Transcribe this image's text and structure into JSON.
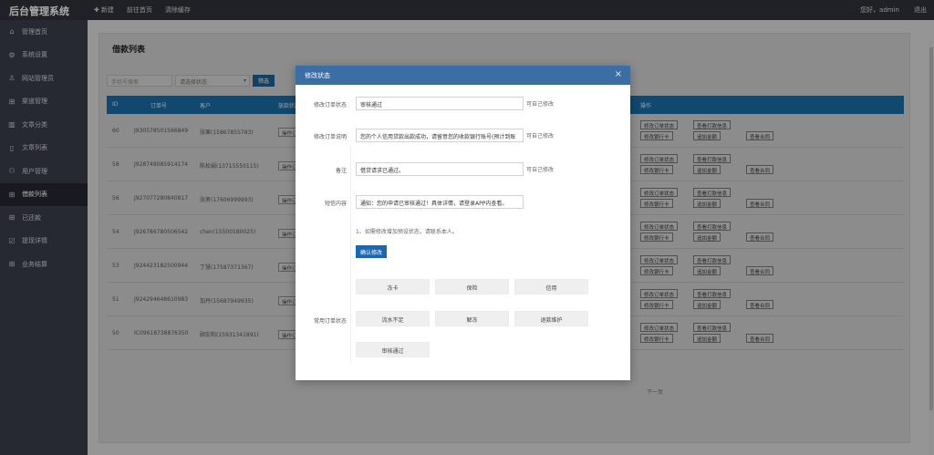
{
  "app": {
    "title": "后台管理系统"
  },
  "topnav": {
    "new_label": "新建",
    "new_icon": "plus-icon",
    "home_label": "前往首页",
    "clear_label": "清除缓存"
  },
  "user": {
    "greeting": "您好，admin",
    "logout": "退出"
  },
  "sidebar": {
    "items": [
      {
        "label": "管理首页",
        "icon": "home-icon"
      },
      {
        "label": "系统设置",
        "icon": "gear-icon"
      },
      {
        "label": "网站管理员",
        "icon": "user-icon"
      },
      {
        "label": "渠道管理",
        "icon": "grid-icon"
      },
      {
        "label": "文章分类",
        "icon": "book-icon"
      },
      {
        "label": "文章列表",
        "icon": "document-icon"
      },
      {
        "label": "用户管理",
        "icon": "users-icon"
      },
      {
        "label": "借款列表",
        "icon": "grid-icon"
      },
      {
        "label": "已还款",
        "icon": "grid-icon"
      },
      {
        "label": "提现详情",
        "icon": "checklist-icon"
      },
      {
        "label": "业务结算",
        "icon": "grid-icon"
      }
    ]
  },
  "page": {
    "title": "借款列表"
  },
  "search": {
    "placeholder": "手机号搜索",
    "status_selected": "请选择状态",
    "button": "筛选"
  },
  "table": {
    "headers": [
      "ID",
      "订单号",
      "客户",
      "放款状态",
      "操作"
    ],
    "rows": [
      {
        "id": "60",
        "order": "J930578501566849",
        "customer": "张栗(15867855783)",
        "op": "操作订"
      },
      {
        "id": "58",
        "order": "J928749085914174",
        "customer": "陈松娟(13715550115)",
        "op": "操作订"
      },
      {
        "id": "56",
        "order": "J927077280840817",
        "customer": "张男(17606999993)",
        "op": "操作订"
      },
      {
        "id": "54",
        "order": "J926786780506542",
        "customer": "chen(15500180025)",
        "op": "操作订"
      },
      {
        "id": "53",
        "order": "J924423182500944",
        "customer": "丁慧(17587371367)",
        "op": "操作订"
      },
      {
        "id": "51",
        "order": "J924294648610983",
        "customer": "加丹(15687949935)",
        "op": "操作订"
      },
      {
        "id": "50",
        "order": "IC09618738876350",
        "customer": "顾宏和(15931341891)",
        "op": "操作订"
      }
    ],
    "row_actions": {
      "edit_status": "修改订单状态",
      "view_print": "查看打款信息",
      "edit_bank": "修改银行卡",
      "add_amount": "追加金额",
      "view_contract": "查看合同"
    }
  },
  "pager": {
    "next": "下一页"
  },
  "modal": {
    "title": "修改状态",
    "close": "×",
    "fields": [
      {
        "label": "修改订单状态",
        "value": "审核通过",
        "note": "可自己修改"
      },
      {
        "label": "修改订单说明",
        "value": "您的个人信用贷款出款成功，请留意您的收款银行账号(预计到账",
        "note": "可自己修改"
      },
      {
        "label": "备注",
        "value": "借贷请求已通过。",
        "note": "可自己修改"
      },
      {
        "label": "短信内容",
        "value": "通知：您的申请已审核通过！具体详情，请登录APP内查看。",
        "note": ""
      }
    ],
    "hint": "1、如需修改增加预设状态，请联系本人。",
    "confirm": "确认修改",
    "quick_label": "常用订单状态",
    "quick_buttons": [
      "冻卡",
      "保险",
      "信用",
      "流水不足",
      "解冻",
      "退款维护",
      "审核通过"
    ]
  }
}
